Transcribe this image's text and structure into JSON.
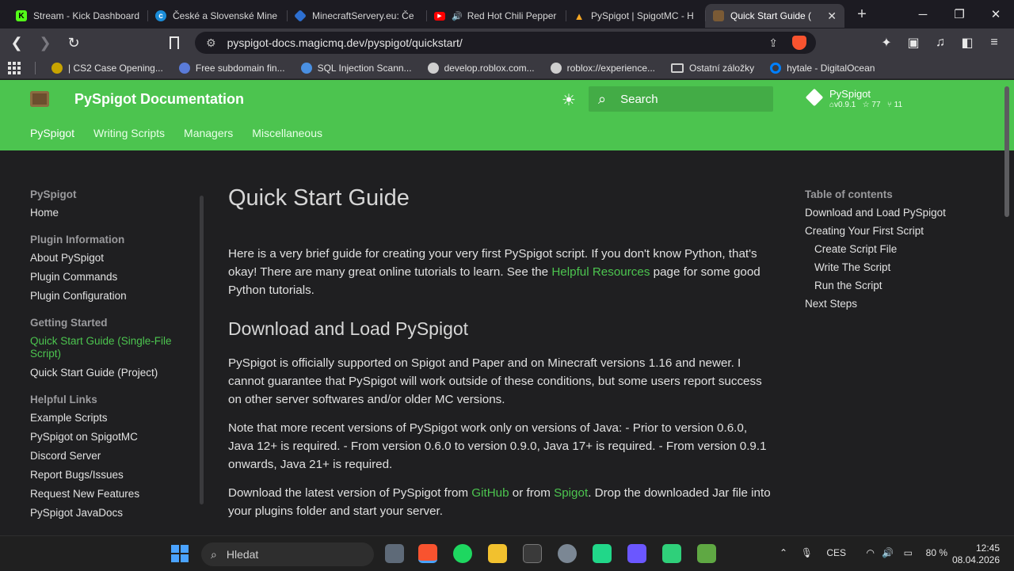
{
  "browser": {
    "tabs": [
      {
        "title": "Stream - Kick Dashboard",
        "favicon": "kick-icon",
        "color": "#53fc18"
      },
      {
        "title": "České a Slovenské Mine",
        "favicon": "cz-sk-icon",
        "color": "#1a8cd8"
      },
      {
        "title": "MinecraftServery.eu: Če",
        "favicon": "cube-icon",
        "color": "#2d6fd1"
      },
      {
        "title": "Red Hot Chili Pepper",
        "favicon": "youtube-icon",
        "color": "#ff0000"
      },
      {
        "title": "PySpigot | SpigotMC - H",
        "favicon": "spigot-icon",
        "color": "#f5a623"
      },
      {
        "title": "Quick Start Guide (",
        "favicon": "pyspigot-icon",
        "color": "#7a5a35"
      }
    ],
    "url": "pyspigot-docs.magicmq.dev/pyspigot/quickstart/",
    "bookmarks": [
      {
        "label": "| CS2 Case Opening...",
        "color": "#c8a400"
      },
      {
        "label": "Free subdomain fin...",
        "color": "#5a7bd8"
      },
      {
        "label": "SQL Injection Scann...",
        "color": "#4a90e2"
      },
      {
        "label": "develop.roblox.com...",
        "color": "#cfcfcf"
      },
      {
        "label": "roblox://experience...",
        "color": "#cfcfcf"
      },
      {
        "label": "Ostatní záložky",
        "color": "#cfcfcf"
      },
      {
        "label": "hytale - DigitalOcean",
        "color": "#0080ff"
      }
    ]
  },
  "site": {
    "title": "PySpigot Documentation",
    "search_placeholder": "Search",
    "repo": {
      "name": "PySpigot",
      "version": "v0.9.1",
      "stars": "77",
      "forks": "11"
    },
    "tabs": [
      "PySpigot",
      "Writing Scripts",
      "Managers",
      "Miscellaneous"
    ],
    "accent": "#4cc44f"
  },
  "sidebar": {
    "sections": [
      {
        "title": "PySpigot",
        "items": [
          "Home"
        ]
      },
      {
        "title": "Plugin Information",
        "items": [
          "About PySpigot",
          "Plugin Commands",
          "Plugin Configuration"
        ]
      },
      {
        "title": "Getting Started",
        "items": [
          "Quick Start Guide (Single-File Script)",
          "Quick Start Guide (Project)"
        ]
      },
      {
        "title": "Helpful Links",
        "items": [
          "Example Scripts",
          "PySpigot on SpigotMC",
          "Discord Server",
          "Report Bugs/Issues",
          "Request New Features",
          "PySpigot JavaDocs"
        ]
      }
    ]
  },
  "content": {
    "h1": "Quick Start Guide",
    "intro_a": "Here is a very brief guide for creating your very first PySpigot script. If you don't know Python, that's okay! There are many great online tutorials to learn. See the ",
    "intro_link": "Helpful Resources",
    "intro_b": " page for some good Python tutorials.",
    "h2": "Download and Load PySpigot",
    "p1": "PySpigot is officially supported on Spigot and Paper and on Minecraft versions 1.16 and newer. I cannot guarantee that PySpigot will work outside of these conditions, but some users report success on other server softwares and/or older MC versions.",
    "p2": "Note that more recent versions of PySpigot work only on versions of Java: - Prior to version 0.6.0, Java 12+ is required. - From version 0.6.0 to version 0.9.0, Java 17+ is required. - From version 0.9.1 onwards, Java 21+ is required.",
    "p3_a": "Download the latest version of PySpigot from ",
    "p3_link1": "GitHub",
    "p3_b": " or from ",
    "p3_link2": "Spigot",
    "p3_c": ". Drop the downloaded Jar file into your plugins folder and start your server."
  },
  "toc": {
    "title": "Table of contents",
    "items": [
      "Download and Load PySpigot",
      "Creating Your First Script",
      "Create Script File",
      "Write The Script",
      "Run the Script",
      "Next Steps"
    ]
  },
  "taskbar": {
    "search": "Hledat",
    "lang": "CES",
    "battery": "80 %",
    "time": "12:45",
    "date": "08.04.2026"
  }
}
